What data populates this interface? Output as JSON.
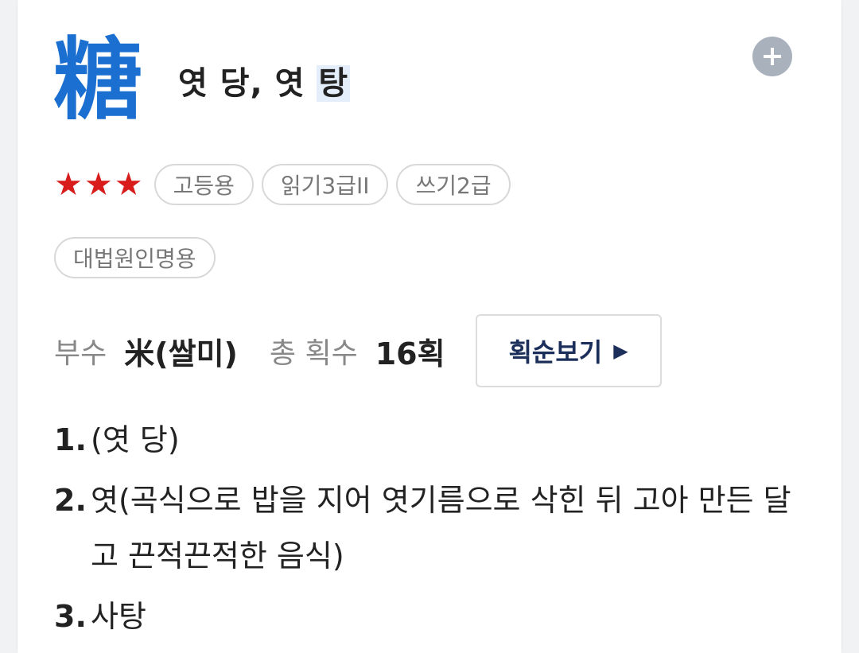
{
  "entry": {
    "hanja": "糖",
    "reading_prefix": "엿 당, 엿 ",
    "reading_highlight": "탕",
    "add_icon": "plus-circle-icon"
  },
  "levels": {
    "stars": 3,
    "star_color": "#d81b1b",
    "tags": [
      "고등용",
      "읽기3급II",
      "쓰기2급"
    ],
    "tags2": [
      "대법원인명용"
    ]
  },
  "info": {
    "radical_label": "부수",
    "radical_value": "米(쌀미)",
    "strokes_label": "총 획수",
    "strokes_value": "16획",
    "stroke_order_button": "획순보기",
    "stroke_order_icon": "play-triangle-icon"
  },
  "definitions": [
    {
      "num": "1.",
      "text": "(엿 당)"
    },
    {
      "num": "2.",
      "text": "엿(곡식으로 밥을 지어 엿기름으로 삭힌 뒤 고아 만든 달고 끈적끈적한 음식)"
    },
    {
      "num": "3.",
      "text": "사탕"
    }
  ],
  "colors": {
    "hanja": "#1a6fd0",
    "highlight_bg": "#e4eefb",
    "button_text": "#1c2f5b"
  }
}
